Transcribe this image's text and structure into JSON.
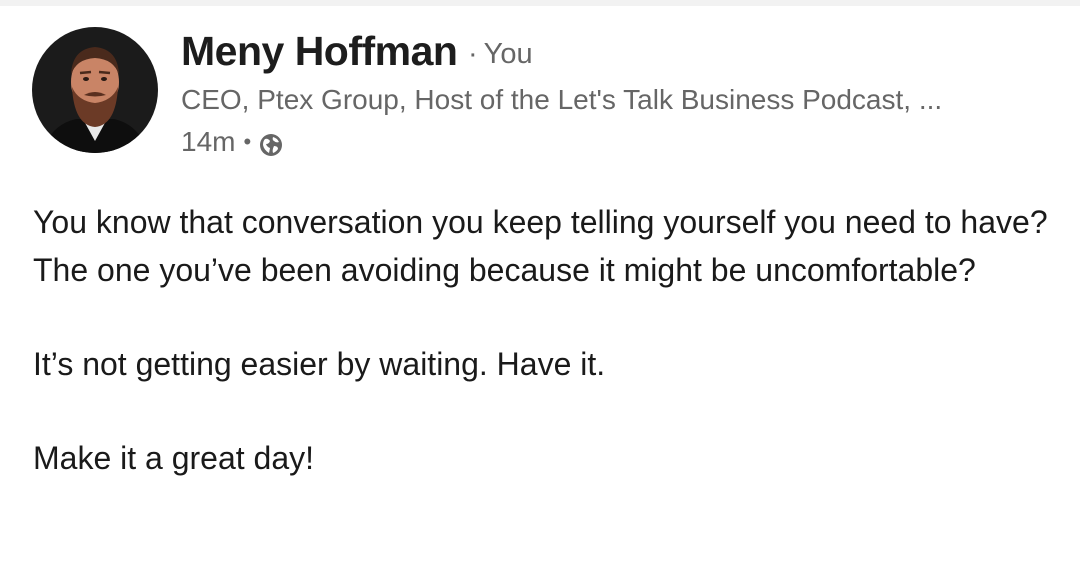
{
  "author": {
    "name": "Meny Hoffman",
    "relationship": "You",
    "separator": "·",
    "headline": "CEO, Ptex Group, Host of the Let's Talk Business Podcast, ...",
    "timestamp": "14m",
    "visibility_icon": "globe-icon",
    "avatar_icon": "profile-photo"
  },
  "post": {
    "paragraphs": [
      "You know that conversation you keep telling yourself you need to have? The one you’ve been avoiding because it might be uncomfortable?",
      "It’s not getting easier by waiting. Have it.",
      "Make it a great day!"
    ]
  },
  "colors": {
    "name": "#1d1d1d",
    "secondary_text": "#666666",
    "body_text": "#1a1a1a",
    "background": "#ffffff"
  }
}
